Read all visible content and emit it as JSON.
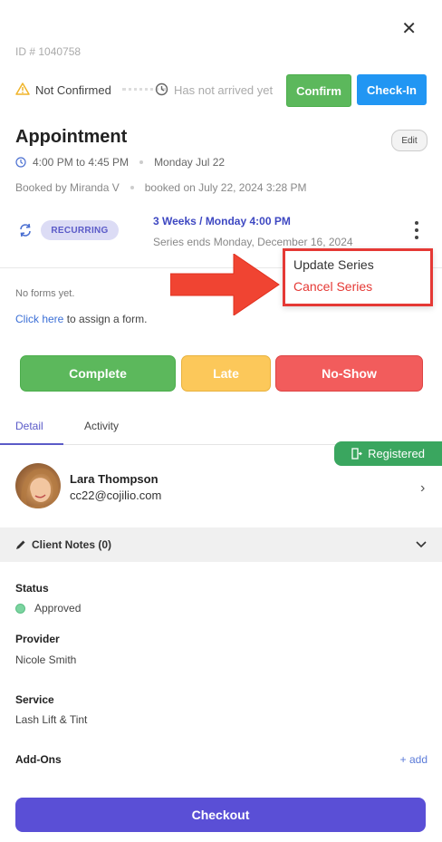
{
  "header": {
    "id_label": "ID # 1040758"
  },
  "status": {
    "confirmation": "Not Confirmed",
    "arrival": "Has not arrived yet",
    "confirm_button": "Confirm",
    "checkin_button": "Check-In"
  },
  "appointment": {
    "title": "Appointment",
    "edit_button": "Edit",
    "time": "4:00 PM to 4:45 PM",
    "date": "Monday Jul 22",
    "booked_by": "Booked by Miranda V",
    "booked_on": "booked on July 22, 2024 3:28 PM",
    "recurring_badge": "RECURRING",
    "series_schedule": "3 Weeks / Monday 4:00 PM",
    "series_end": "Series ends Monday, December 16, 2024"
  },
  "series_menu": {
    "items": [
      "Update Series",
      "Cancel Series"
    ]
  },
  "forms": {
    "none_text": "No forms yet.",
    "link_text": "Click here",
    "suffix_text": " to assign a form."
  },
  "actions": {
    "complete": "Complete",
    "late": "Late",
    "no_show": "No-Show"
  },
  "tabs": [
    {
      "label": "Detail",
      "active": true
    },
    {
      "label": "Activity",
      "active": false
    }
  ],
  "client": {
    "registered_badge": "Registered",
    "name": "Lara Thompson",
    "email": "cc22@cojilio.com"
  },
  "notes": {
    "label": "Client Notes (0)"
  },
  "details": {
    "status_label": "Status",
    "status_value": "Approved",
    "provider_label": "Provider",
    "provider_value": "Nicole Smith",
    "service_label": "Service",
    "service_value": "Lash Lift & Tint",
    "addons_label": "Add-Ons",
    "add_link": "+ add"
  },
  "footer": {
    "checkout_button": "Checkout"
  },
  "colors": {
    "confirm": "#5cb85c",
    "checkin": "#2196f3",
    "late": "#fcc85a",
    "no_show": "#f25c5c",
    "registered": "#3aa65f",
    "checkout": "#5a4fd6",
    "highlight": "#e53935"
  }
}
